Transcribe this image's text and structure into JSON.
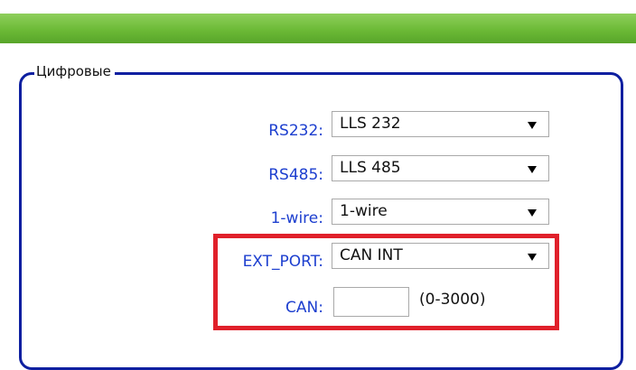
{
  "section": {
    "legend": "Цифровые"
  },
  "fields": {
    "rs232": {
      "label": "RS232:",
      "value": "LLS 232"
    },
    "rs485": {
      "label": "RS485:",
      "value": "LLS 485"
    },
    "onewire": {
      "label": "1-wire:",
      "value": "1-wire"
    },
    "ext_port": {
      "label": "EXT_PORT:",
      "value": "CAN INT"
    },
    "can": {
      "label": "CAN:",
      "value": "",
      "range": "(0-3000)"
    }
  },
  "colors": {
    "header_green": "#6cba36",
    "fieldset_border": "#0d1fa0",
    "label_blue": "#1d3fcf",
    "highlight_red": "#e0202a"
  },
  "icons": {
    "dropdown": "triangle-down"
  }
}
